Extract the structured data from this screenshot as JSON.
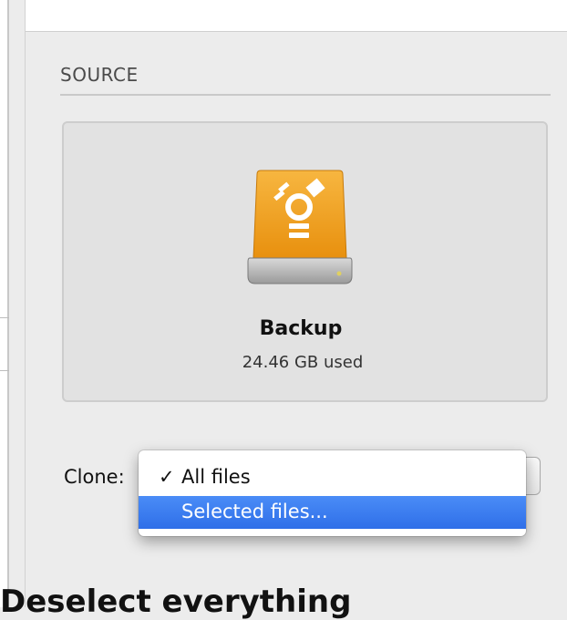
{
  "source": {
    "header": "SOURCE",
    "disk": {
      "name": "Backup",
      "usage": "24.46 GB used",
      "icon": "external-drive-firewire-icon",
      "icon_color": "#f0a11c"
    }
  },
  "clone": {
    "label": "Clone:",
    "menu": {
      "items": [
        {
          "label": "All files",
          "checked": true,
          "check_mark": "✓"
        },
        {
          "label": "Selected files...",
          "highlighted": true
        }
      ],
      "highlight_color": "#3a7cf0"
    }
  },
  "caption": "Deselect everything"
}
